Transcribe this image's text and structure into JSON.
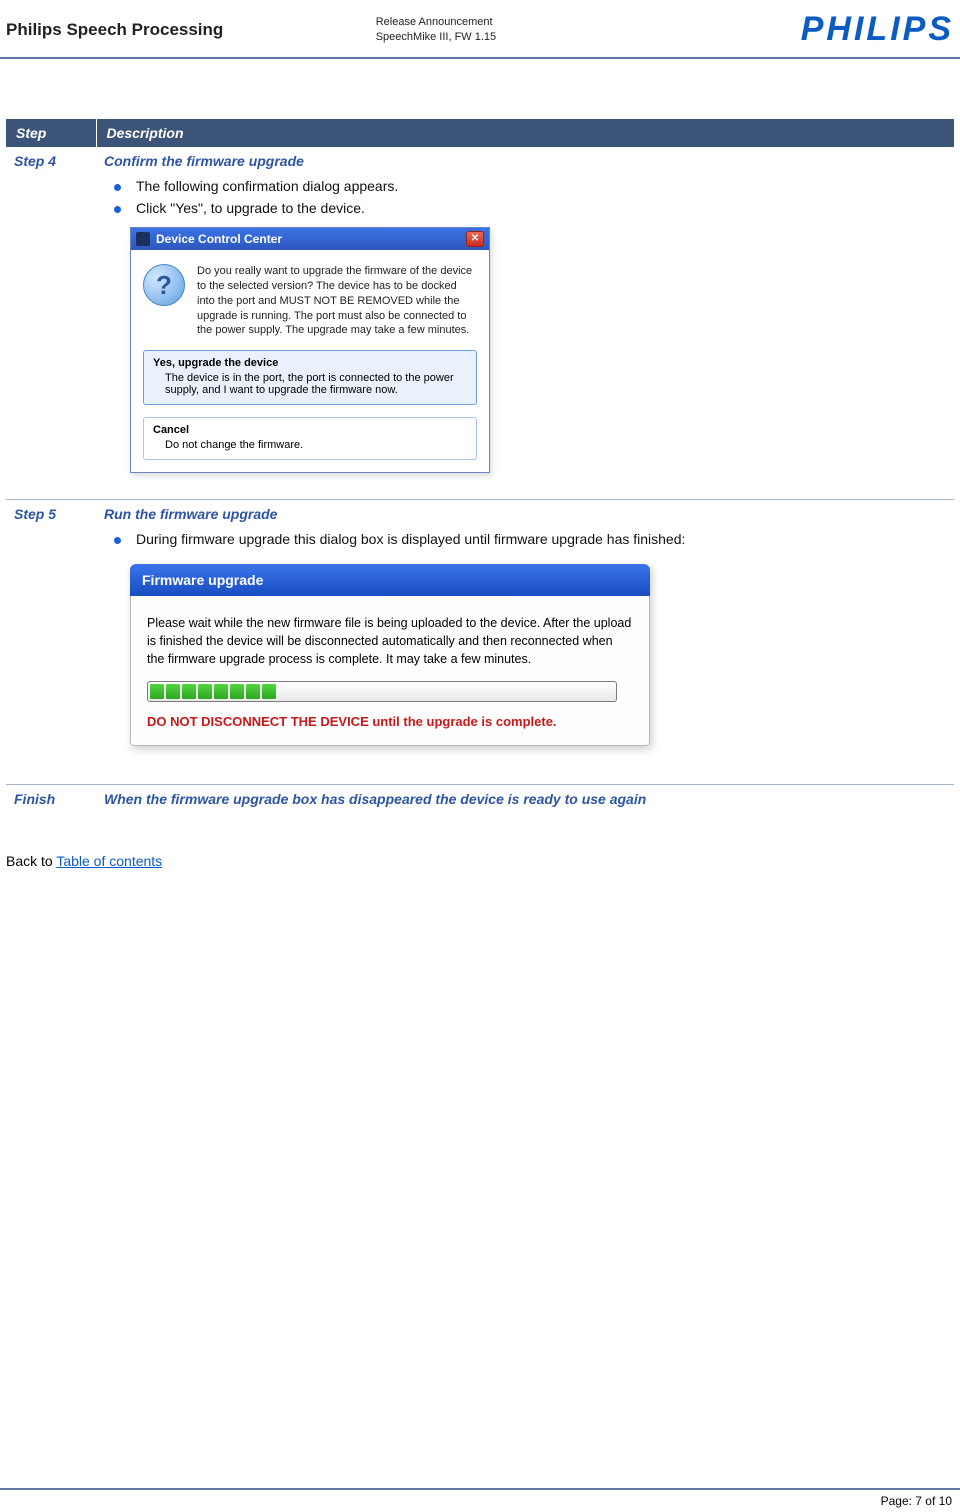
{
  "header": {
    "left": "Philips Speech Processing",
    "centerLine1": "Release Announcement",
    "centerLine2": "SpeechMike III, FW 1.15",
    "logo": "PHILIPS"
  },
  "table": {
    "colStep": "Step",
    "colDesc": "Description",
    "step4Label": "Step 4",
    "step4Title": "Confirm the firmware upgrade",
    "step4Bullet1": "The following confirmation dialog appears.",
    "step4Bullet2": "Click \"Yes\", to upgrade to the device.",
    "step5Label": "Step 5",
    "step5Title": "Run the firmware upgrade",
    "step5Bullet1": "During firmware upgrade this dialog box is displayed until firmware upgrade has finished:",
    "finishLabel": "Finish",
    "finishText": "When the firmware upgrade box has disappeared the device is ready to use again"
  },
  "dlg1": {
    "title": "Device Control Center",
    "closeGlyph": "✕",
    "question": "Do you really want to upgrade the firmware of the device to the selected version? The device has to be docked into the port and MUST NOT BE REMOVED while the upgrade is running. The port must also be connected to the power supply. The upgrade may take a few minutes.",
    "opt1Title": "Yes, upgrade the device",
    "opt1Text": "The device is in the port, the port is connected to the power supply, and I want to upgrade the firmware now.",
    "opt2Title": "Cancel",
    "opt2Text": "Do not change the firmware."
  },
  "dlg2": {
    "title": "Firmware upgrade",
    "text": "Please wait while the new firmware file is being uploaded to the device. After the upload is finished the device will be disconnected automatically and then reconnected when the firmware upgrade process is complete. It may take a few minutes.",
    "warn": "DO NOT DISCONNECT THE DEVICE until the upgrade is complete."
  },
  "backText": "Back to ",
  "backLink": "Table of contents",
  "footer": "Page: 7 of 10"
}
